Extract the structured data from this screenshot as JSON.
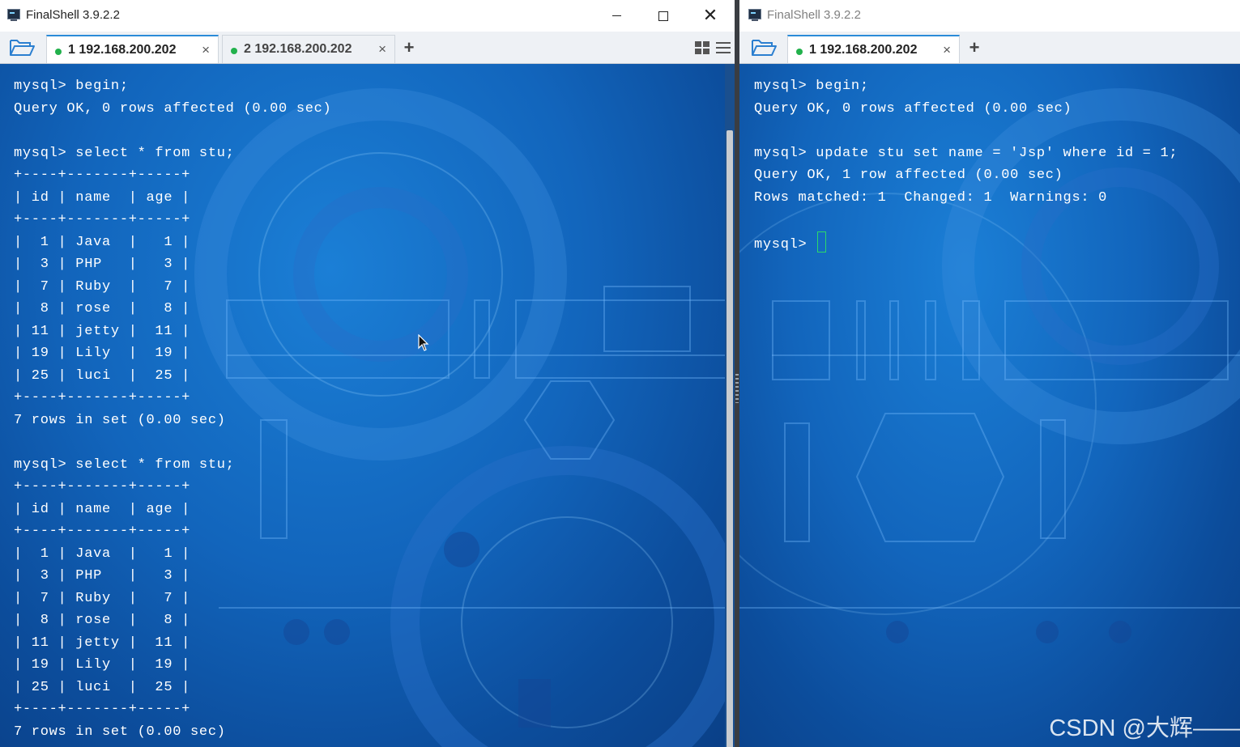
{
  "left_window": {
    "title": "FinalShell 3.9.2.2",
    "tabs": [
      {
        "label": "1 192.168.200.202",
        "active": true,
        "status_color": "#22b14c"
      },
      {
        "label": "2 192.168.200.202",
        "active": false,
        "status_color": "#22b14c"
      }
    ],
    "terminal_lines": [
      "mysql> begin;",
      "Query OK, 0 rows affected (0.00 sec)",
      "",
      "mysql> select * from stu;",
      "+----+-------+-----+",
      "| id | name  | age |",
      "+----+-------+-----+",
      "|  1 | Java  |   1 |",
      "|  3 | PHP   |   3 |",
      "|  7 | Ruby  |   7 |",
      "|  8 | rose  |   8 |",
      "| 11 | jetty |  11 |",
      "| 19 | Lily  |  19 |",
      "| 25 | luci  |  25 |",
      "+----+-------+-----+",
      "7 rows in set (0.00 sec)",
      "",
      "mysql> select * from stu;",
      "+----+-------+-----+",
      "| id | name  | age |",
      "+----+-------+-----+",
      "|  1 | Java  |   1 |",
      "|  3 | PHP   |   3 |",
      "|  7 | Ruby  |   7 |",
      "|  8 | rose  |   8 |",
      "| 11 | jetty |  11 |",
      "| 19 | Lily  |  19 |",
      "| 25 | luci  |  25 |",
      "+----+-------+-----+",
      "7 rows in set (0.00 sec)"
    ]
  },
  "right_window": {
    "title": "FinalShell 3.9.2.2",
    "tabs": [
      {
        "label": "1 192.168.200.202",
        "active": true,
        "status_color": "#22b14c"
      }
    ],
    "terminal_lines": [
      "mysql> begin;",
      "Query OK, 0 rows affected (0.00 sec)",
      "",
      "mysql> update stu set name = 'Jsp' where id = 1;",
      "Query OK, 1 row affected (0.00 sec)",
      "Rows matched: 1  Changed: 1  Warnings: 0",
      ""
    ],
    "prompt": "mysql> "
  },
  "icons": {
    "app": "finalshell-app-icon",
    "folder": "folder-open-icon",
    "tab_close": "close-icon",
    "add_tab": "plus-icon",
    "layout": "grid-layout-icon",
    "menu": "hamburger-menu-icon"
  },
  "glyphs": {
    "tab_close": "×",
    "add_tab": "+",
    "window_close": "✕"
  },
  "watermark": "CSDN @大辉——",
  "colors": {
    "terminal_text": "#ffffff",
    "tab_active_accent": "#2b8bd8",
    "status_online": "#22b14c",
    "cursor": "#2bd96a"
  }
}
